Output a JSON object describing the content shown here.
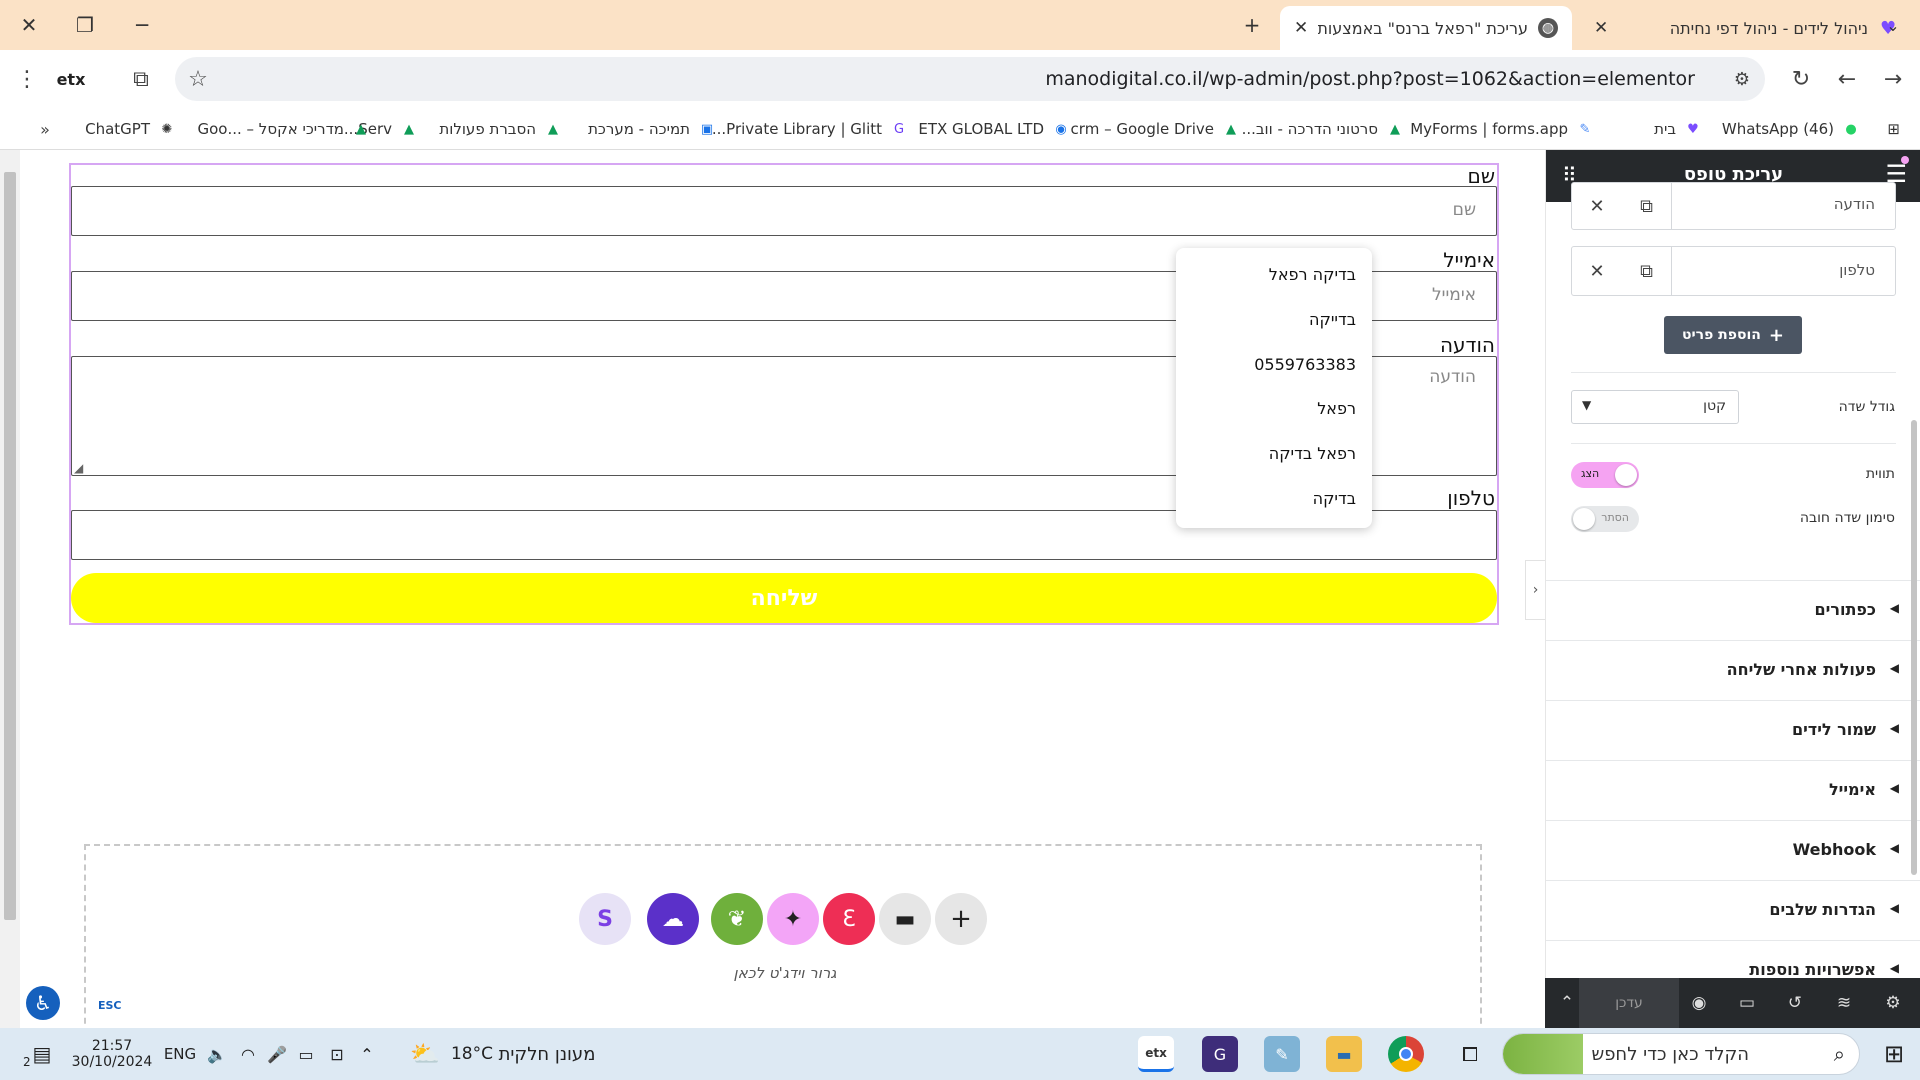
{
  "browser": {
    "tabs": [
      {
        "title": "ניהול לידים - ניהול דפי נחיתה",
        "active": false
      },
      {
        "title": "עריכת \"רפאל ברנס\" באמצעות אלמנטור",
        "active": true
      }
    ],
    "new_tab": "+",
    "url": "manodigital.co.il/wp-admin/post.php?post=1062&action=elementor",
    "bookmarks": [
      {
        "label": "(46) WhatsApp",
        "icon": "whatsapp-icon",
        "color": "#25d366"
      },
      {
        "label": "בית",
        "icon": "heart-icon",
        "color": "#7b4dff"
      },
      {
        "label": "MyForms | forms.app",
        "icon": "forms-icon",
        "color": "#4c8bf5"
      },
      {
        "label": "סרטוני הדרכה - ווב...",
        "icon": "drive-icon",
        "color": "#0f9d58"
      },
      {
        "label": "crm – Google Drive",
        "icon": "drive-icon",
        "color": "#0f9d58"
      },
      {
        "label": "ETX GLOBAL LTD",
        "icon": "etx-icon",
        "color": "#1a73e8"
      },
      {
        "label": "Private Library | Glitt...",
        "icon": "glitter-icon",
        "color": "#6c3ef5"
      },
      {
        "label": "תמיכה - מערכת",
        "icon": "calendar-icon",
        "color": "#1a73e8"
      },
      {
        "label": "הסברת פעולות",
        "icon": "drive-icon",
        "color": "#0f9d58"
      },
      {
        "label": "Serv...",
        "icon": "drive-icon",
        "color": "#0f9d58"
      },
      {
        "label": "מדריכי אקסל – ...Goo",
        "icon": "drive-icon",
        "color": "#0f9d58"
      },
      {
        "label": "ChatGPT",
        "icon": "chatgpt-icon",
        "color": "#333333"
      }
    ]
  },
  "form": {
    "fields": [
      {
        "label": "שם",
        "placeholder": "שם"
      },
      {
        "label": "אימייל",
        "placeholder": "אימייל"
      },
      {
        "label": "הודעה",
        "placeholder": "הודעה"
      },
      {
        "label": "טלפון",
        "placeholder": ""
      }
    ],
    "submit_label": "שליחה",
    "submit_color": "#ffff00"
  },
  "autofill": [
    "בדיקה רפאל",
    "בדייקה",
    "0559763383",
    "רפאל",
    "רפאל בדיקה",
    "בדיקה"
  ],
  "dropzone": {
    "text": "גרור וידג'ט לכאן",
    "buttons": [
      {
        "icon": "plus-icon",
        "color": "#e6e6e6"
      },
      {
        "icon": "folder-icon",
        "color": "#e6e6e6"
      },
      {
        "icon": "elementor-kit-icon",
        "color": "#ee2e55"
      },
      {
        "icon": "ai-sparkle-icon",
        "color": "#f3a5f7"
      },
      {
        "icon": "leaf-icon",
        "color": "#6fb03c"
      },
      {
        "icon": "cloud-icon",
        "color": "#5b30c9"
      },
      {
        "icon": "s-logo-icon",
        "color": "#e7e2f6"
      }
    ],
    "esc": "ESC"
  },
  "panel": {
    "title": "עריכת טופס",
    "repeater": [
      "הודעה",
      "טלפון"
    ],
    "add_item": "הוספת פריט",
    "field_size": {
      "label": "גודל שדה",
      "value": "קטן"
    },
    "label_toggle": {
      "label": "תווית",
      "state": "הצג",
      "on": true,
      "color": "#f5a3f2"
    },
    "required_toggle": {
      "label": "סימון שדה חובה",
      "state": "הסתר",
      "on": false
    },
    "sections": [
      "כפתורים",
      "פעולות אחרי שליחה",
      "שמור לידים",
      "אימייל",
      "Webhook",
      "הגדרות שלבים",
      "אפשרויות נוספות"
    ],
    "update_label": "עדכן"
  },
  "taskbar": {
    "search_placeholder": "הקלד כאן כדי לחפש",
    "weather": "מעונן חלקית",
    "temperature": "18°C",
    "language": "ENG",
    "time": "21:57",
    "date": "30/10/2024",
    "notifications": "2"
  }
}
